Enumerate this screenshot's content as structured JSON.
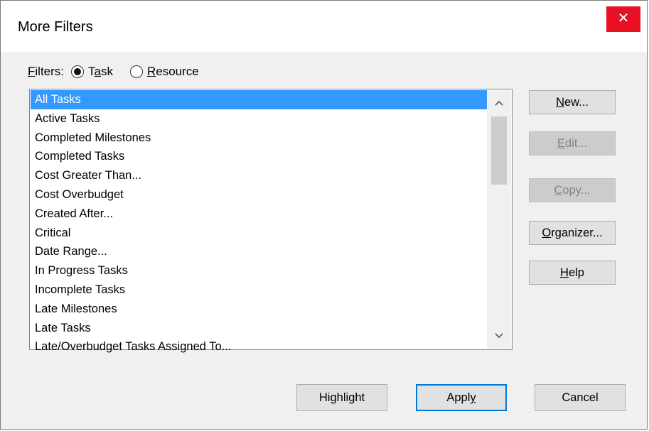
{
  "window": {
    "title": "More Filters",
    "close_glyph": "✕"
  },
  "filters": {
    "label_pre": "",
    "label_u": "F",
    "label_post": "ilters:",
    "task": {
      "pre": "T",
      "u": "a",
      "post": "sk",
      "checked": true
    },
    "resource": {
      "pre": "",
      "u": "R",
      "post": "esource",
      "checked": false
    }
  },
  "list": {
    "items": [
      "All Tasks",
      "Active Tasks",
      "Completed Milestones",
      "Completed Tasks",
      "Cost Greater Than...",
      "Cost Overbudget",
      "Created After...",
      "Critical",
      "Date Range...",
      "In Progress Tasks",
      "Incomplete Tasks",
      "Late Milestones",
      "Late Tasks",
      "Late/Overbudget Tasks Assigned To..."
    ],
    "selected_index": 0
  },
  "side_buttons": {
    "new": {
      "pre": "",
      "u": "N",
      "post": "ew..."
    },
    "edit": {
      "pre": "",
      "u": "E",
      "post": "dit..."
    },
    "copy": {
      "pre": "",
      "u": "C",
      "post": "opy..."
    },
    "organizer": {
      "pre": "",
      "u": "O",
      "post": "rganizer..."
    },
    "help": {
      "pre": "",
      "u": "H",
      "post": "elp"
    }
  },
  "bottom_buttons": {
    "highlight": {
      "pre": "Hi",
      "u": "g",
      "post": "hlight"
    },
    "apply": {
      "pre": "Appl",
      "u": "y",
      "post": ""
    },
    "cancel": {
      "pre": "Cancel",
      "u": "",
      "post": ""
    }
  },
  "icons": {
    "scroll_up": "chevron-up-icon",
    "scroll_down": "chevron-down-icon",
    "close": "close-icon"
  },
  "colors": {
    "selection": "#3399ff",
    "close_bg": "#e81123",
    "default_border": "#0078d7"
  }
}
